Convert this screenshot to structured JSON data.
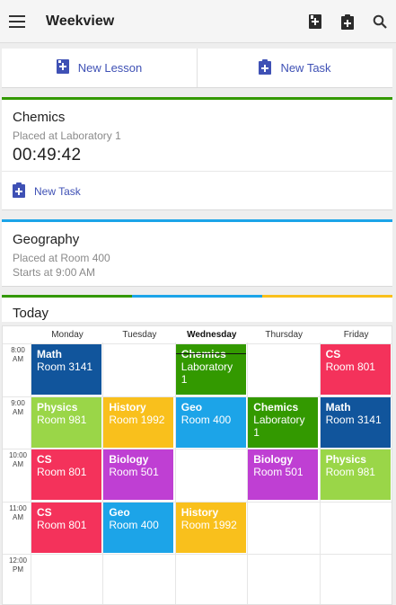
{
  "appbar": {
    "title": "Weekview",
    "icons": [
      "menu-icon",
      "new-lesson-icon",
      "new-task-icon",
      "search-icon"
    ]
  },
  "actions": {
    "new_lesson": "New Lesson",
    "new_task": "New Task"
  },
  "current": {
    "accent": "#339900",
    "name": "Chemics",
    "location": "Placed at Laboratory 1",
    "timer": "00:49:42",
    "new_task": "New Task"
  },
  "next": {
    "accent": "#1ca4e8",
    "name": "Geography",
    "location": "Placed at Room 400",
    "starts": "Starts at 9:00 AM"
  },
  "today": {
    "label": "Today",
    "stripes": [
      "#339900",
      "#1ca4e8",
      "#f9c01c"
    ]
  },
  "week": {
    "days": [
      "Monday",
      "Tuesday",
      "Wednesday",
      "Thursday",
      "Friday"
    ],
    "active_day": "Wednesday",
    "times": [
      {
        "h": "8:00",
        "ap": "AM"
      },
      {
        "h": "9:00",
        "ap": "AM"
      },
      {
        "h": "10:00",
        "ap": "AM"
      },
      {
        "h": "11:00",
        "ap": "AM"
      },
      {
        "h": "12:00",
        "ap": "PM"
      }
    ],
    "lessons": [
      {
        "day": 0,
        "slot": 0,
        "name": "Math",
        "room": "Room 3141",
        "color": "#11559c"
      },
      {
        "day": 2,
        "slot": 0,
        "name": "Chemics",
        "room": "Laboratory 1",
        "color": "#339900",
        "current": true
      },
      {
        "day": 4,
        "slot": 0,
        "name": "CS",
        "room": "Room 801",
        "color": "#f4325b"
      },
      {
        "day": 0,
        "slot": 1,
        "name": "Physics",
        "room": "Room 981",
        "color": "#9ad648"
      },
      {
        "day": 1,
        "slot": 1,
        "name": "History",
        "room": "Room 1992",
        "color": "#f9c01c"
      },
      {
        "day": 2,
        "slot": 1,
        "name": "Geo",
        "room": "Room 400",
        "color": "#1ca4e8"
      },
      {
        "day": 3,
        "slot": 1,
        "name": "Chemics",
        "room": "Laboratory 1",
        "color": "#339900"
      },
      {
        "day": 4,
        "slot": 1,
        "name": "Math",
        "room": "Room 3141",
        "color": "#11559c"
      },
      {
        "day": 0,
        "slot": 2,
        "name": "CS",
        "room": "Room 801",
        "color": "#f4325b"
      },
      {
        "day": 1,
        "slot": 2,
        "name": "Biology",
        "room": "Room 501",
        "color": "#bf3fd3"
      },
      {
        "day": 3,
        "slot": 2,
        "name": "Biology",
        "room": "Room 501",
        "color": "#bf3fd3"
      },
      {
        "day": 4,
        "slot": 2,
        "name": "Physics",
        "room": "Room 981",
        "color": "#9ad648"
      },
      {
        "day": 0,
        "slot": 3,
        "name": "CS",
        "room": "Room 801",
        "color": "#f4325b"
      },
      {
        "day": 1,
        "slot": 3,
        "name": "Geo",
        "room": "Room 400",
        "color": "#1ca4e8"
      },
      {
        "day": 2,
        "slot": 3,
        "name": "History",
        "room": "Room 1992",
        "color": "#f9c01c"
      }
    ]
  }
}
